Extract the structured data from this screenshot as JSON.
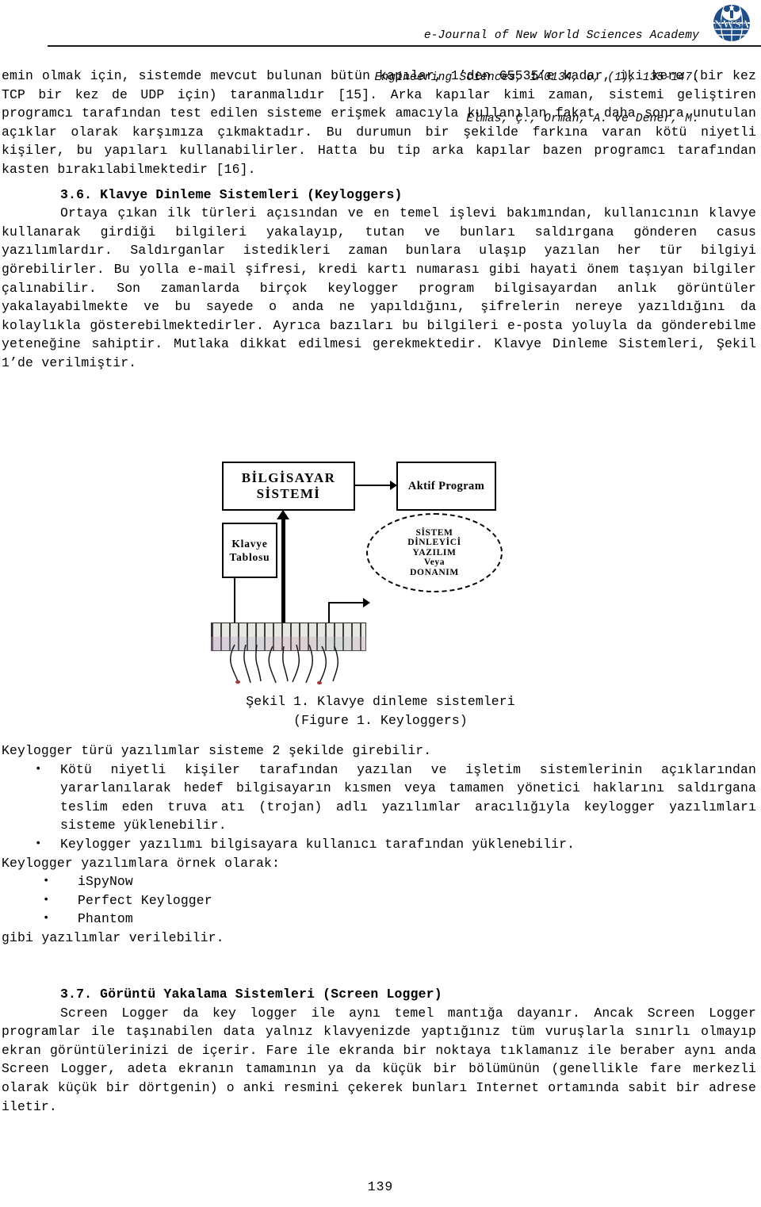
{
  "header": {
    "line1": "e-Journal of New World Sciences Academy",
    "line2": "Engineering Sciences, 1A0134, 6, (1), 135-147.",
    "line3": "Elmas, Ç., Orman, A. ve Dener, M.",
    "logo_text": "NWSA",
    "logo_color": "#1f4e87"
  },
  "body": {
    "para1": "emin olmak için, sistemde mevcut bulunan bütün kapılar, 1’den 65535’e kadar, iki kere (bir kez TCP bir kez de UDP için) taranmalıdır [15]. Arka kapılar kimi zaman, sistemi geliştiren programcı tarafından test edilen sisteme erişmek amacıyla kullanılan fakat daha sonra unutulan açıklar olarak karşımıza çıkmaktadır. Bu durumun bir şekilde farkına varan kötü niyetli kişiler, bu yapıları kullanabilirler. Hatta bu tip arka kapılar bazen programcı tarafından kasten bırakılabilmektedir [16].",
    "section36_heading": "3.6. Klavye Dinleme Sistemleri (Keyloggers)",
    "para2": "Ortaya çıkan ilk türleri açısından ve en temel işlevi bakımından, kullanıcının klavye kullanarak girdiği bilgileri yakalayıp, tutan ve bunları saldırgana gönderen casus yazılımlardır. Saldırganlar istedikleri zaman bunlara ulaşıp yazılan her tür bilgiyi görebilirler. Bu yolla e-mail şifresi, kredi kartı numarası gibi hayati önem taşıyan bilgiler çalınabilir. Son zamanlarda birçok keylogger program bilgisayardan anlık görüntüler yakalayabilmekte ve bu sayede o anda ne yapıldığını, şifrelerin nereye yazıldığını da kolaylıkla gösterebilmektedirler. Ayrıca bazıları bu bilgileri e-posta yoluyla da gönderebilme yeteneğine sahiptir. Mutlaka dikkat edilmesi gerekmektedir. Klavye Dinleme Sistemleri, Şekil 1’de verilmiştir.",
    "intro_list": "Keylogger türü yazılımlar sisteme 2 şekilde girebilir.",
    "list1": [
      "Kötü niyetli kişiler tarafından yazılan ve işletim sistemlerinin açıklarından yararlanılarak hedef bilgisayarın kısmen veya tamamen yönetici haklarını saldırgana teslim eden truva atı (trojan) adlı yazılımlar aracılığıyla keylogger yazılımları sisteme yüklenebilir.",
      "Keylogger yazılımı bilgisayara kullanıcı tarafından yüklenebilir."
    ],
    "examples_intro": "Keylogger yazılımlara örnek olarak:",
    "examples": [
      "iSpyNow",
      "Perfect Keylogger",
      "Phantom"
    ],
    "examples_outro": "gibi yazılımlar verilebilir.",
    "section37_heading": "3.7. Görüntü Yakalama Sistemleri (Screen Logger)",
    "para3": "Screen Logger da key logger ile aynı temel mantığa dayanır. Ancak Screen Logger programlar ile taşınabilen data yalnız klavyenizde yaptığınız tüm vuruşlarla sınırlı olmayıp ekran görüntülerinizi de içerir. Fare ile ekranda bir noktaya tıklamanız ile beraber aynı anda Screen Logger, adeta ekranın tamamının ya da küçük bir bölümünün (genellikle fare merkezli olarak küçük bir dörtgenin) o anki resmini çekerek bunları Internet ortamında sabit bir adrese iletir.",
    "bullet_glyph": "•"
  },
  "figure": {
    "box_computer": "BİLGİSAYAR\nSİSTEMİ",
    "box_active_program": "Aktif Program",
    "box_keyboard_table": "Klavye\nTablosu",
    "ellipse_listener": "SİSTEM\nDİNLEYİCİ\nYAZILIM\nVeya\nDONANIM",
    "caption_line1": "Şekil 1. Klavye dinleme sistemleri",
    "caption_line2": "(Figure 1. Keyloggers)"
  },
  "footer": {
    "page_number": "139"
  }
}
